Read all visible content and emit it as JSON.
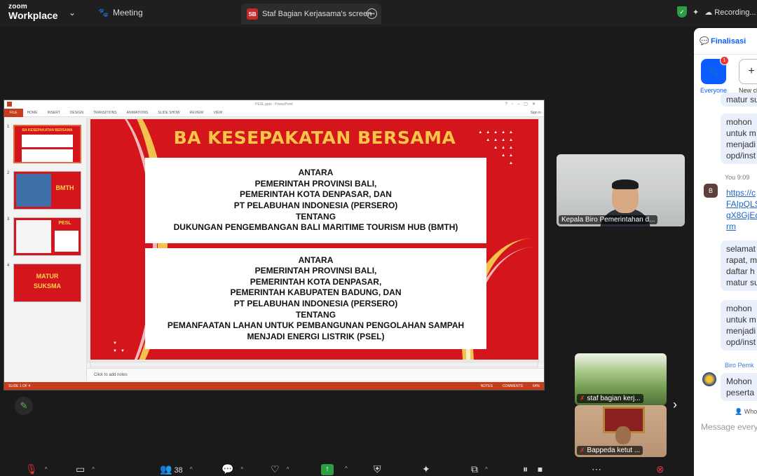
{
  "app": {
    "logo_line1": "zoom",
    "logo_line2": "Workplace",
    "meeting_label": "Meeting",
    "share_tab_badge": "SB",
    "share_tab_label": "Staf Bagian Kerjasama's screen",
    "recording_label": "Recording..."
  },
  "ppt": {
    "window_title": "PESL.pptx - PowerPoint",
    "ribbon_tabs": [
      "FILE",
      "HOME",
      "INSERT",
      "DESIGN",
      "TRANSITIONS",
      "ANIMATIONS",
      "SLIDE SHOW",
      "REVIEW",
      "VIEW"
    ],
    "sign_in": "Sign in",
    "thumb_numbers": [
      "1",
      "2",
      "3",
      "4"
    ],
    "thumb1_title": "BA KESEPAKATAN BERSAMA",
    "thumb2_title": "BMTH",
    "thumb3_title": "PESL",
    "thumb4_line1": "MATUR",
    "thumb4_line2": "SUKSMA",
    "notes_placeholder": "Click to add notes",
    "status_slide": "SLIDE 1 OF 4",
    "status_notes": "NOTES",
    "status_comments": "COMMENTS",
    "zoom_level": "64%"
  },
  "slide": {
    "title": "BA KESEPAKATAN BERSAMA",
    "box1_lines": [
      "ANTARA",
      "PEMERINTAH PROVINSI BALI,",
      "PEMERINTAH KOTA DENPASAR, DAN",
      "PT PELABUHAN INDONESIA (PERSERO)",
      "TENTANG",
      "DUKUNGAN PENGEMBANGAN BALI MARITIME TOURISM HUB (BMTH)"
    ],
    "box2_lines": [
      "ANTARA",
      "PEMERINTAH PROVINSI BALI,",
      "PEMERINTAH KOTA DENPASAR,",
      "PEMERINTAH KABUPATEN BADUNG, DAN",
      "PT PELABUHAN INDONESIA (PERSERO)",
      "TENTANG",
      "PEMANFAATAN LAHAN UNTUK PEMBANGUNAN PENGOLAHAN SAMPAH",
      "MENJADI ENERGI LISTRIK (PSEL)"
    ]
  },
  "videos": {
    "tile1_name": "Kepala Biro Pemerintahan d...",
    "tile2_name": "staf bagian kerj...",
    "tile3_name": "Bappeda ketut ..."
  },
  "chat": {
    "header": "Finalisasi",
    "group_everyone": "Everyone",
    "group_badge": "1",
    "group_new": "New ch",
    "bubble_top": "matur su",
    "bubble_a": [
      "mohon",
      "untuk m",
      "menjadi",
      "opd/inst"
    ],
    "sender_you": "You 9:09",
    "avatar_b": "B",
    "link_lines": [
      "https://c",
      "FAIpQLS",
      "gX8GjEd",
      "rm"
    ],
    "bubble_c": [
      "selamat",
      "rapat, m",
      "daftar h",
      "matur su"
    ],
    "bubble_d": [
      "mohon",
      "untuk m",
      "menjadi",
      "opd/inst"
    ],
    "sender_biro": "Biro Pemk",
    "bubble_e": [
      "Mohon",
      "peserta"
    ],
    "who_label": "Who",
    "message_placeholder": "Message every"
  },
  "toolbar": {
    "participants_count": "38"
  }
}
